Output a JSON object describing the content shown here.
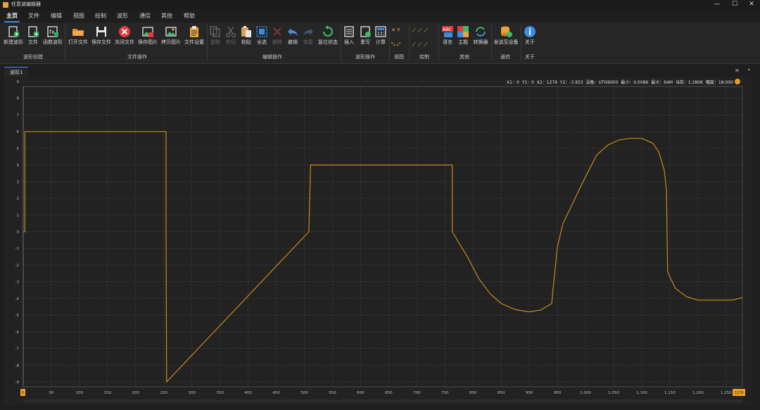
{
  "window": {
    "title": "任意波编辑器",
    "minimize": "—",
    "maximize": "☐",
    "close": "✕"
  },
  "menu": [
    "主页",
    "文件",
    "编辑",
    "视图",
    "绘制",
    "波形",
    "通信",
    "其他",
    "帮助"
  ],
  "ribbon": {
    "buttons": [
      {
        "label": "新建波形",
        "icon": "new-waveform-icon"
      },
      {
        "label": "文件",
        "icon": "new-file-icon"
      },
      {
        "label": "函数波形",
        "icon": "function-waveform-icon"
      },
      {
        "label": "打开文件",
        "icon": "open-folder-icon"
      },
      {
        "label": "保存文件",
        "icon": "save-icon"
      },
      {
        "label": "关闭文件",
        "icon": "close-file-icon"
      },
      {
        "label": "保存图片",
        "icon": "save-image-icon"
      },
      {
        "label": "拷贝图片",
        "icon": "copy-image-icon"
      },
      {
        "label": "文件设置",
        "icon": "file-settings-icon"
      },
      {
        "label": "复制",
        "icon": "copy-icon"
      },
      {
        "label": "剪切",
        "icon": "cut-icon"
      },
      {
        "label": "粘贴",
        "icon": "paste-icon"
      },
      {
        "label": "全选",
        "icon": "select-all-icon"
      },
      {
        "label": "删除",
        "icon": "delete-icon"
      },
      {
        "label": "撤销",
        "icon": "undo-icon"
      },
      {
        "label": "恢复",
        "icon": "redo-icon"
      },
      {
        "label": "复位状态",
        "icon": "reset-icon"
      },
      {
        "label": "插入",
        "icon": "insert-icon"
      },
      {
        "label": "重写",
        "icon": "rewrite-icon"
      },
      {
        "label": "计算",
        "icon": "calculate-icon"
      },
      {
        "label": "语言",
        "icon": "language-icon"
      },
      {
        "label": "主题",
        "icon": "theme-icon"
      },
      {
        "label": "转换器",
        "icon": "converter-icon"
      },
      {
        "label": "发送至设备",
        "icon": "send-device-icon"
      },
      {
        "label": "关于",
        "icon": "about-icon"
      }
    ],
    "groups": [
      "波形创建",
      "文件操作",
      "编辑操作",
      "波形操作",
      "视图",
      "绘制",
      "其他",
      "通信",
      "关于"
    ],
    "view_axes": [
      "X",
      "Y"
    ]
  },
  "tab": {
    "label": "波形1",
    "close": "✕",
    "menu": "▾"
  },
  "status": {
    "x1_label": "X1：",
    "x1": "0",
    "y1_label": "Y1：",
    "y1": "0",
    "x2_label": "X2：",
    "x2": "1279",
    "y2_label": "Y2：",
    "y2": "-3.953",
    "device_label": "设备：",
    "device": "UTG9000",
    "min_label": "最小：",
    "min": "0.008K",
    "max_label": "最大：",
    "max": "64M",
    "current_label": "当前：",
    "current": "1.280K",
    "amp_label": "幅度：",
    "amp": "18.000"
  },
  "colors": {
    "waveform": "#c98a1b",
    "accent": "#3a8ee6",
    "marker": "#f0a020"
  },
  "chart_data": {
    "type": "line",
    "title": "",
    "xlim": [
      0,
      1279
    ],
    "ylim": [
      -9,
      9
    ],
    "x_ticks": [
      50,
      100,
      150,
      200,
      250,
      300,
      350,
      400,
      450,
      500,
      550,
      600,
      650,
      700,
      750,
      800,
      850,
      900,
      950,
      1000,
      1050,
      1100,
      1150,
      1200,
      1250
    ],
    "x_tick_labels": [
      "50",
      "100",
      "150",
      "200",
      "250",
      "300",
      "350",
      "400",
      "450",
      "500",
      "550",
      "600",
      "650",
      "700",
      "750",
      "800",
      "850",
      "900",
      "950",
      "1,000",
      "1,050",
      "1,100",
      "1,150",
      "1,200",
      "1,250"
    ],
    "y_ticks": [
      9,
      8,
      7,
      6,
      5,
      4,
      3,
      2,
      1,
      0,
      -1,
      -2,
      -3,
      -4,
      -5,
      -6,
      -7,
      -8,
      -9
    ],
    "y_tick_labels": [
      "9",
      "8",
      "7",
      "6",
      "5",
      "4",
      "3",
      "2",
      "1",
      "0",
      "-1",
      "-2",
      "-3",
      "-4",
      "-5",
      "-6",
      "-7",
      "-8",
      "-9"
    ],
    "marker_left": "0",
    "marker_right": "1279",
    "grid": true,
    "series": [
      {
        "x": [
          0,
          3,
          3,
          254,
          254,
          255,
          508,
          508,
          511,
          511,
          763,
          763,
          770,
          790,
          810,
          830,
          850,
          870,
          880,
          900,
          920,
          940,
          942,
          944,
          950,
          960,
          980,
          1000,
          1020,
          1040,
          1060,
          1080,
          1100,
          1120,
          1130,
          1140,
          1144,
          1146,
          1150,
          1160,
          1180,
          1200,
          1220,
          1240,
          1260,
          1279
        ],
        "y": [
          0,
          0,
          6,
          6,
          0,
          -9,
          0,
          0,
          4,
          4,
          4,
          0,
          -0.4,
          -1.5,
          -2.8,
          -3.7,
          -4.3,
          -4.6,
          -4.7,
          -4.8,
          -4.7,
          -4.3,
          -3.5,
          -2.9,
          -0.9,
          0.5,
          1.9,
          3.3,
          4.6,
          5.2,
          5.5,
          5.6,
          5.6,
          5.3,
          4.8,
          3.7,
          2.5,
          -2.4,
          -2.7,
          -3.4,
          -3.9,
          -4.1,
          -4.1,
          -4.1,
          -4.1,
          -3.95
        ]
      }
    ]
  }
}
